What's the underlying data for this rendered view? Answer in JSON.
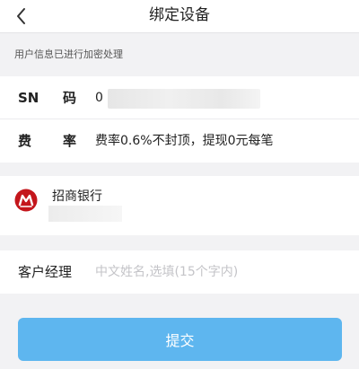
{
  "header": {
    "title": "绑定设备"
  },
  "notice": "用户信息已进行加密处理",
  "device": {
    "sn_label_1": "SN",
    "sn_label_2": "码",
    "sn_value": "0",
    "rate_label_1": "费",
    "rate_label_2": "率",
    "rate_value": "费率0.6%不封顶，提现0元每笔"
  },
  "bank": {
    "name": "招商银行",
    "logo_icon": "cmb-logo-icon",
    "logo_color": "#c4161c"
  },
  "manager": {
    "label": "客户经理",
    "placeholder": "中文姓名,选填(15个字内)",
    "value": ""
  },
  "submit": {
    "label": "提交",
    "color": "#5eb6ef"
  }
}
